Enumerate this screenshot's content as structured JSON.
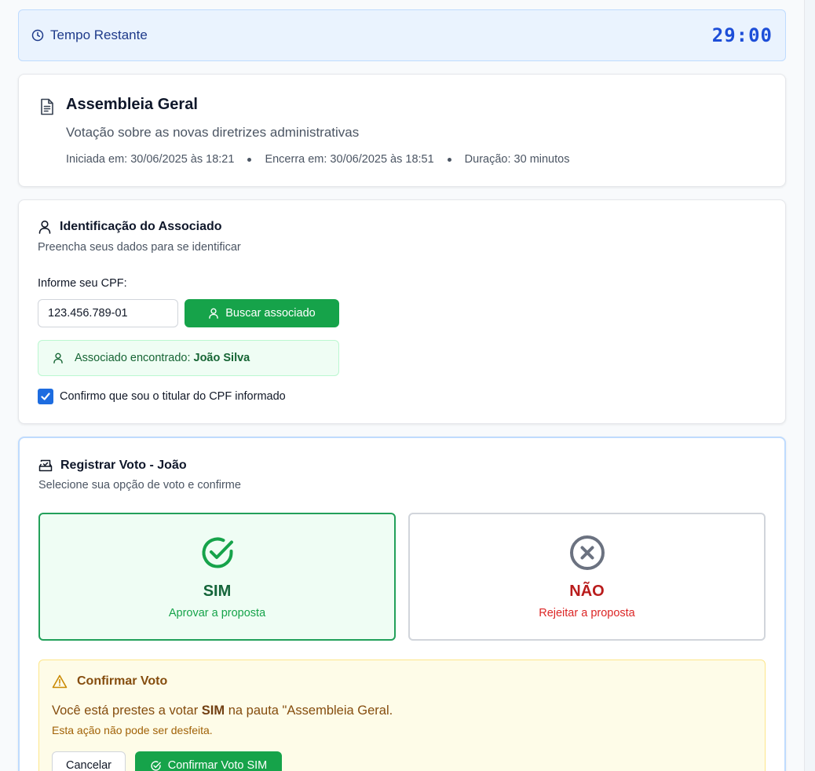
{
  "timer": {
    "label": "Tempo Restante",
    "value": "29:00"
  },
  "assembly": {
    "title": "Assembleia Geral",
    "description": "Votação sobre as novas diretrizes administrativas",
    "started": "Iniciada em: 30/06/2025 às 18:21",
    "ends": "Encerra em: 30/06/2025 às 18:51",
    "duration": "Duração: 30 minutos"
  },
  "identification": {
    "title": "Identificação do Associado",
    "subtitle": "Preencha seus dados para se identificar",
    "cpf_label": "Informe seu CPF:",
    "cpf_value": "123.456.789-01",
    "search_button": "Buscar associado",
    "found_prefix": "Associado encontrado:",
    "found_name": "João Silva",
    "confirm_checkbox_label": "Confirmo que sou o titular do CPF informado",
    "confirm_checked": true
  },
  "vote": {
    "title": "Registrar Voto - João",
    "subtitle": "Selecione sua opção de voto e confirme",
    "options": [
      {
        "label": "SIM",
        "description": "Aprovar a proposta",
        "selected": true
      },
      {
        "label": "NÃO",
        "description": "Rejeitar a proposta",
        "selected": false
      }
    ],
    "confirm": {
      "title": "Confirmar Voto",
      "text_before": "Você está prestes a votar",
      "text_choice": "SIM",
      "text_after": "na pauta \"Assembleia Geral.",
      "warning": "Esta ação não pode ser desfeita.",
      "cancel_button": "Cancelar",
      "confirm_button": "Confirmar Voto SIM"
    }
  },
  "colors": {
    "primary_green": "#16a34a",
    "timer_blue": "#1d4ed8",
    "reject_red": "#b91c1c",
    "warning_amber": "#854d0e"
  }
}
